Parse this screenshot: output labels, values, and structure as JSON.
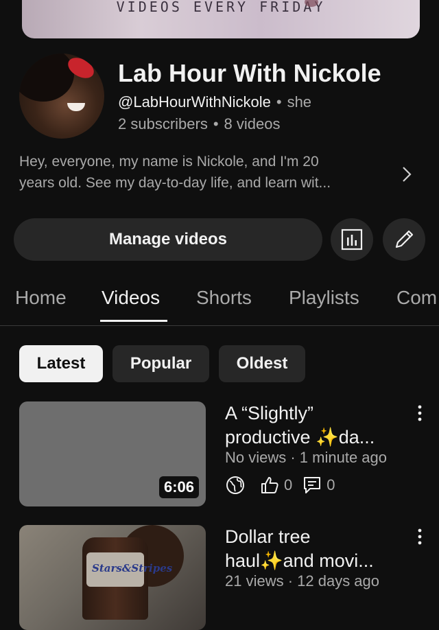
{
  "channel": {
    "banner_text": "VIDEOS EVERY  FRIDAY",
    "name": "Lab Hour With Nickole",
    "handle": "@LabHourWithNickole",
    "pronouns": "she",
    "subscribers": "2 subscribers",
    "videos_count": "8 videos",
    "description_line1": "Hey, everyone, my name is Nickole, and I'm 20",
    "description_line2": "years old. See my day-to-day life, and learn wit..."
  },
  "actions": {
    "manage_videos": "Manage videos",
    "analytics_icon": "analytics-icon",
    "edit_icon": "pencil-icon"
  },
  "tabs": [
    "Home",
    "Videos",
    "Shorts",
    "Playlists",
    "Com"
  ],
  "active_tab": "Videos",
  "filters": [
    "Latest",
    "Popular",
    "Oldest"
  ],
  "selected_filter": "Latest",
  "videos": [
    {
      "title_line1": "A “Slightly”",
      "title_line2": "productive ✨da...",
      "meta": "No views · 1 minute ago",
      "duration": "6:06",
      "likes": "0",
      "comments": "0",
      "visibility_icon": "globe-icon"
    },
    {
      "title_line1": "Dollar tree",
      "title_line2": "haul✨and movi...",
      "meta": "21 views · 12 days ago",
      "thumb_label": "Stars&Stripes"
    }
  ],
  "colors": {
    "background": "#0f0f0f",
    "surface": "#272727",
    "text": "#f1f1f1",
    "secondary": "#aaaaaa"
  }
}
